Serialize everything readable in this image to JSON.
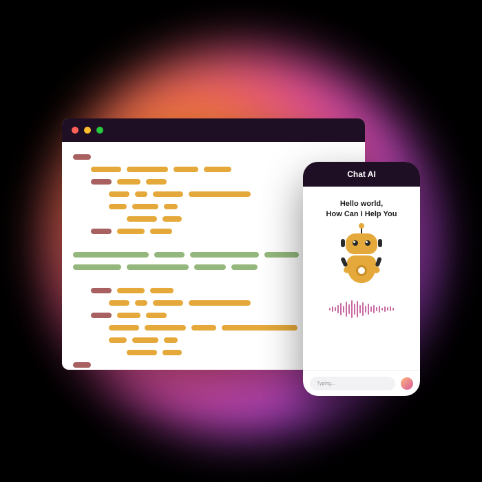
{
  "editor": {
    "window_controls": [
      "close",
      "minimize",
      "maximize"
    ],
    "code_icon_label": "code-icon",
    "lines": "decorative code bars"
  },
  "phone": {
    "header_title": "Chat AI",
    "greeting_line1": "Hello world,",
    "greeting_line2": "How Can I Help You",
    "input_placeholder": "Typing..."
  },
  "colors": {
    "maroon": "#a86060",
    "gold": "#e4a93a",
    "sage": "#93b77c",
    "titlebar": "#1f0f24"
  }
}
